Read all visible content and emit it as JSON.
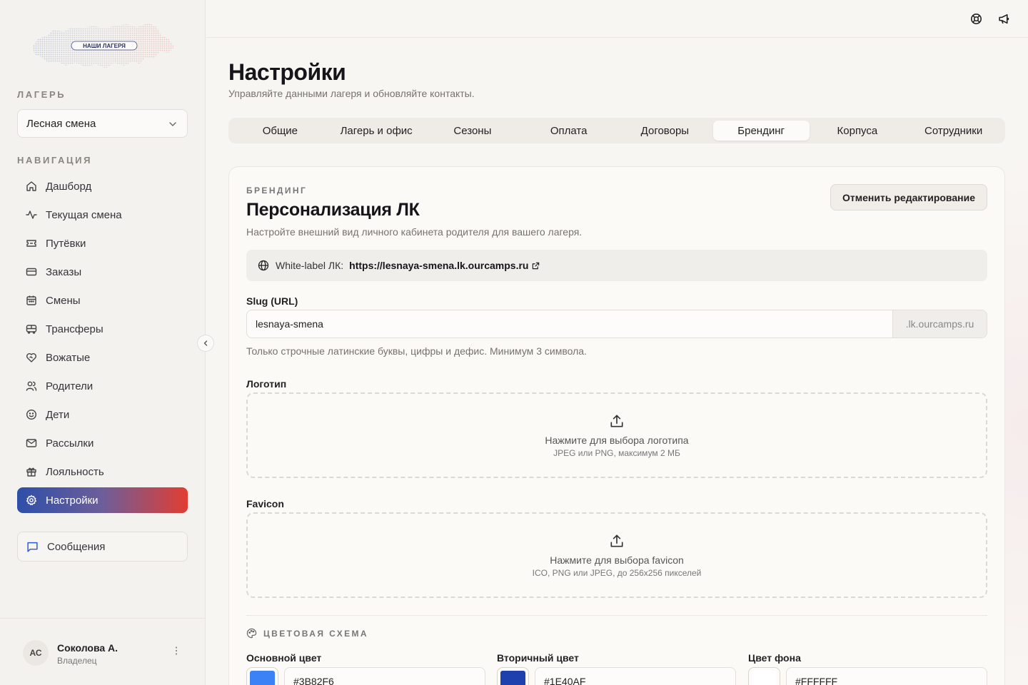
{
  "sidebar": {
    "logo_text": "НАШИ ЛАГЕРЯ",
    "camp_label": "ЛАГЕРЬ",
    "camp_selected": "Лесная смена",
    "nav_label": "НАВИГАЦИЯ",
    "items": [
      {
        "label": "Дашборд",
        "icon": "home-icon"
      },
      {
        "label": "Текущая смена",
        "icon": "activity-icon"
      },
      {
        "label": "Путёвки",
        "icon": "ticket-icon"
      },
      {
        "label": "Заказы",
        "icon": "credit-card-icon"
      },
      {
        "label": "Смены",
        "icon": "calendar-icon"
      },
      {
        "label": "Трансферы",
        "icon": "bus-icon"
      },
      {
        "label": "Вожатые",
        "icon": "heart-handshake-icon"
      },
      {
        "label": "Родители",
        "icon": "users-icon"
      },
      {
        "label": "Дети",
        "icon": "smile-icon"
      },
      {
        "label": "Рассылки",
        "icon": "mail-icon"
      },
      {
        "label": "Лояльность",
        "icon": "gift-icon"
      },
      {
        "label": "Настройки",
        "icon": "settings-icon",
        "active": true
      }
    ],
    "messages_label": "Сообщения",
    "user": {
      "initials": "АС",
      "name": "Соколова А.",
      "role": "Владелец"
    }
  },
  "page": {
    "title": "Настройки",
    "subtitle": "Управляйте данными лагеря и обновляйте контакты.",
    "tabs": [
      "Общие",
      "Лагерь и офис",
      "Сезоны",
      "Оплата",
      "Договоры",
      "Брендинг",
      "Корпуса",
      "Сотрудники"
    ],
    "active_tab": "Брендинг"
  },
  "card": {
    "eyebrow": "БРЕНДИНГ",
    "title": "Персонализация ЛК",
    "subtitle": "Настройте внешний вид личного кабинета родителя для вашего лагеря.",
    "cancel_label": "Отменить редактирование",
    "white_label": {
      "label": "White-label ЛК:",
      "url": "https://lesnaya-smena.lk.ourcamps.ru"
    },
    "slug": {
      "label": "Slug (URL)",
      "value": "lesnaya-smena",
      "suffix": ".lk.ourcamps.ru",
      "hint": "Только строчные латинские буквы, цифры и дефис. Минимум 3 символа."
    },
    "logo": {
      "label": "Логотип",
      "cta": "Нажмите для выбора логотипа",
      "note": "JPEG или PNG, максимум 2 МБ"
    },
    "favicon": {
      "label": "Favicon",
      "cta": "Нажмите для выбора favicon",
      "note": "ICO, PNG или JPEG, до 256x256 пикселей"
    },
    "scheme": {
      "label": "ЦВЕТОВАЯ СХЕМА",
      "colors": [
        {
          "label": "Основной цвет",
          "value": "#3B82F6",
          "swatch": "#3B82F6"
        },
        {
          "label": "Вторичный цвет",
          "value": "#1E40AF",
          "swatch": "#1E40AF"
        },
        {
          "label": "Цвет фона",
          "value": "#FFFFFF",
          "swatch": "#FFFFFF"
        }
      ]
    }
  },
  "colors": {
    "accent_blue": "#2e4fa8",
    "accent_red": "#e23d32"
  }
}
